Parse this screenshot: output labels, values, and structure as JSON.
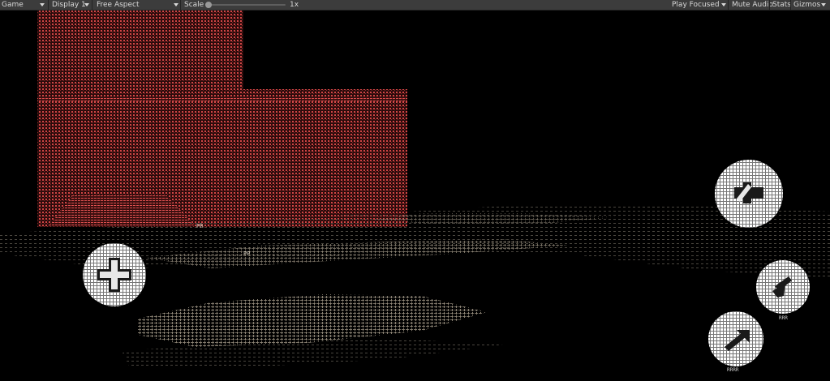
{
  "toolbar": {
    "view_label": "Game",
    "display_label": "Display 1",
    "aspect_label": "Free Aspect",
    "scale_label": "Scale",
    "scale_value": "1x",
    "play_mode_label": "Play Focused",
    "mute_label": "Mute Audio",
    "stats_label": "Stats",
    "gizmos_label": "Gizmos"
  },
  "game": {
    "render_style": "ascii",
    "ascii_fragments": {
      "floor_marker_top": "PR",
      "floor_marker_center": "PP",
      "dash_button_caption": "RRR",
      "jump_button_caption": "RRRR"
    },
    "colors": {
      "background": "#000000",
      "wall": "#c83a3a",
      "floor_ascii": "#b8b0a0",
      "buttons": "#ffffff"
    }
  },
  "controls": {
    "joystick_icon": "dpad-icon",
    "action_icon": "action-icon",
    "dash_icon": "dash-icon",
    "jump_icon": "jump-icon"
  }
}
